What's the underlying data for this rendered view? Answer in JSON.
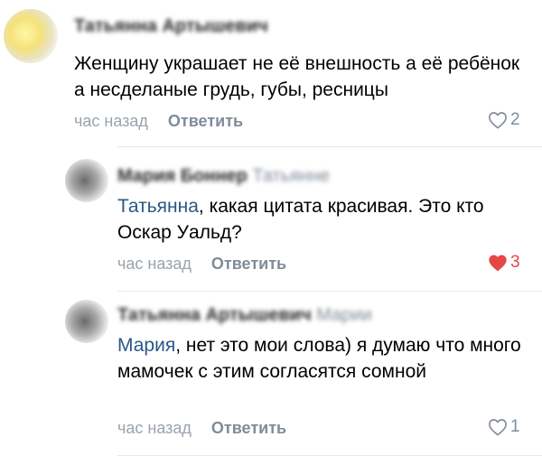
{
  "comments": [
    {
      "author": "Татьянна Артышевич",
      "text": "Женщину украшает не её внешность а её ребёнок а несделаные грудь, губы, ресницы",
      "time": "час назад",
      "reply_label": "Ответить",
      "likes": "2",
      "liked": false
    },
    {
      "author": "Мария Боннер",
      "reply_to": "Татьянне",
      "mention": "Татьянна",
      "text": ", какая цитата красивая. Это кто Оскар Уальд?",
      "time": "час назад",
      "reply_label": "Ответить",
      "likes": "3",
      "liked": true
    },
    {
      "author": "Татьянна Артышевич",
      "reply_to": "Марии",
      "mention": "Мария",
      "text": ", нет это мои слова) я думаю что много мамочек с этим согласятся сомной",
      "time": "час назад",
      "reply_label": "Ответить",
      "likes": "1",
      "liked": false
    }
  ],
  "colors": {
    "link": "#2a5885",
    "secondary": "#818c99",
    "like_active": "#e64646"
  }
}
